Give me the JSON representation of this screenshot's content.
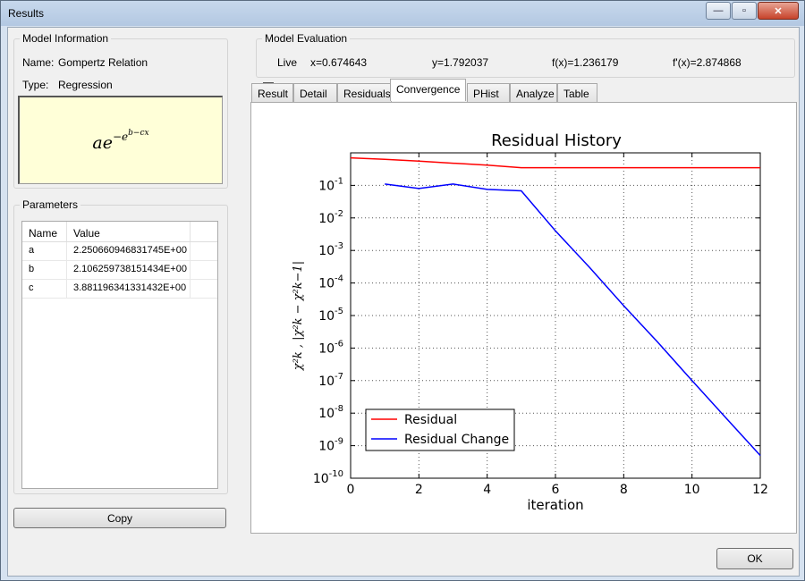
{
  "window": {
    "title": "Results",
    "minimize_glyph": "—",
    "maximize_glyph": "▫",
    "close_glyph": "✕"
  },
  "model_info": {
    "group_title": "Model Information",
    "name_label": "Name:",
    "name_value": "Gompertz Relation",
    "type_label": "Type:",
    "type_value": "Regression",
    "formula": {
      "base": "ae",
      "exp_sign": "−",
      "exp_base": "e",
      "exp_exponent": "b−cx"
    }
  },
  "parameters": {
    "group_title": "Parameters",
    "columns": [
      "Name",
      "Value"
    ],
    "rows": [
      {
        "name": "a",
        "value": "2.250660946831745E+00"
      },
      {
        "name": "b",
        "value": "2.106259738151434E+00"
      },
      {
        "name": "c",
        "value": "3.881196341331432E+00"
      }
    ]
  },
  "copy_button": "Copy",
  "ok_button": "OK",
  "model_eval": {
    "group_title": "Model Evaluation",
    "live_label": "Live",
    "live_checked": true,
    "x": "x=0.674643",
    "y": "y=1.792037",
    "fx": "f(x)=1.236179",
    "fpx": "f'(x)=2.874868"
  },
  "tabs": [
    {
      "label": "Result",
      "active": false
    },
    {
      "label": "Detail",
      "active": false
    },
    {
      "label": "Residuals",
      "active": false
    },
    {
      "label": "Convergence",
      "active": true
    },
    {
      "label": "PHist",
      "active": false
    },
    {
      "label": "Analyze",
      "active": false
    },
    {
      "label": "Table",
      "active": false
    }
  ],
  "chart_data": {
    "type": "line",
    "title": "Residual History",
    "xlabel": "iteration",
    "ylabel": "χ²k , |χ²k − χ²k−1|",
    "xlim": [
      0,
      12
    ],
    "ylim": [
      1e-10,
      1
    ],
    "y_scale": "log",
    "x_ticks": [
      0,
      2,
      4,
      6,
      8,
      10,
      12
    ],
    "y_ticks": [
      1e-10,
      1e-09,
      1e-08,
      1e-07,
      1e-06,
      1e-05,
      0.0001,
      0.001,
      0.01,
      0.1
    ],
    "grid": true,
    "legend_position": "bottom-left",
    "series": [
      {
        "name": "Residual",
        "color": "#ff0000",
        "x": [
          0,
          1,
          2,
          3,
          4,
          5,
          6,
          7,
          8,
          9,
          10,
          11,
          12
        ],
        "y": [
          0.7,
          0.63,
          0.56,
          0.48,
          0.42,
          0.35,
          0.35,
          0.35,
          0.35,
          0.35,
          0.35,
          0.35,
          0.35
        ]
      },
      {
        "name": "Residual Change",
        "color": "#0000ff",
        "x": [
          1,
          2,
          3,
          4,
          5,
          6,
          7,
          8,
          9,
          10,
          11,
          12
        ],
        "y": [
          0.11,
          0.08,
          0.11,
          0.075,
          0.068,
          0.004,
          0.0003,
          2e-05,
          1.5e-06,
          1e-07,
          7e-09,
          5e-10
        ]
      }
    ]
  }
}
